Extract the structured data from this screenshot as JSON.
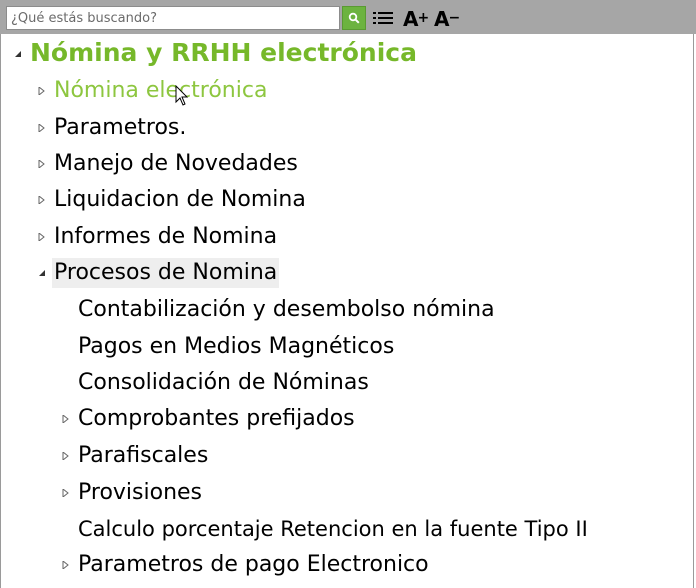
{
  "search": {
    "placeholder": "¿Qué estás buscando?"
  },
  "toolbar": {
    "search_icon": "search-icon",
    "list_icon": "list-icon",
    "increase_font_label": "A",
    "increase_font_sign": "+",
    "decrease_font_label": "A",
    "decrease_font_sign": "−"
  },
  "tree": {
    "root": {
      "label": "Nómina y RRHH electrónica",
      "expanded": true
    },
    "items": [
      {
        "label": "Nómina electrónica",
        "expandable": true,
        "expanded": false,
        "hover": true
      },
      {
        "label": "Parametros.",
        "expandable": true,
        "expanded": false
      },
      {
        "label": "Manejo de Novedades",
        "expandable": true,
        "expanded": false
      },
      {
        "label": "Liquidacion de Nomina",
        "expandable": true,
        "expanded": false
      },
      {
        "label": "Informes de Nomina",
        "expandable": true,
        "expanded": false
      },
      {
        "label": "Procesos de Nomina",
        "expandable": true,
        "expanded": true,
        "selected": true
      }
    ],
    "children": [
      {
        "label": "Contabilización y desembolso nómina",
        "expandable": false
      },
      {
        "label": "Pagos en Medios Magnéticos",
        "expandable": false
      },
      {
        "label": "Consolidación de Nóminas",
        "expandable": false
      },
      {
        "label": "Comprobantes prefijados",
        "expandable": true
      },
      {
        "label": "Parafiscales",
        "expandable": true
      },
      {
        "label": "Provisiones",
        "expandable": true
      },
      {
        "label": "Calculo porcentaje Retencion en la fuente Tipo II",
        "expandable": false
      },
      {
        "label": "Parametros de pago Electronico",
        "expandable": true
      }
    ]
  },
  "colors": {
    "accent": "#76b82a",
    "hover": "#8dc63f",
    "toolbar": "#a6a6a6",
    "search_button": "#6cb33f"
  }
}
